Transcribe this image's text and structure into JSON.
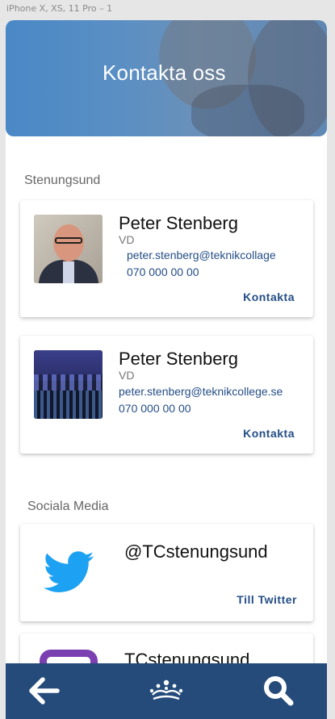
{
  "artboard": {
    "label": "iPhone X, XS, 11 Pro – 1"
  },
  "header": {
    "title": "Kontakta oss"
  },
  "sections": {
    "location": {
      "label": "Stenungsund"
    },
    "social": {
      "label": "Sociala Media"
    }
  },
  "contacts": [
    {
      "name": "Peter Stenberg",
      "role": "VD",
      "email": "peter.stenberg@teknikcollage",
      "phone": "070 000 00 00",
      "action": "Kontakta"
    },
    {
      "name": "Peter Stenberg",
      "role": "VD",
      "email": "peter.stenberg@teknikcollege.se",
      "phone": "070 000 00 00",
      "action": "Kontakta"
    }
  ],
  "social": [
    {
      "handle": "@TCstenungsund",
      "action": "Till Twitter",
      "icon": "twitter-icon"
    },
    {
      "handle": "TCstenungsund",
      "icon": "instagram-icon"
    }
  ],
  "nav": {
    "icons": [
      "arrow-left-icon",
      "crown-logo-icon",
      "search-icon"
    ]
  },
  "colors": {
    "primary": "#244b7a",
    "link": "#244e86",
    "twitter": "#1da1f2",
    "hero": "#4a88c6"
  }
}
